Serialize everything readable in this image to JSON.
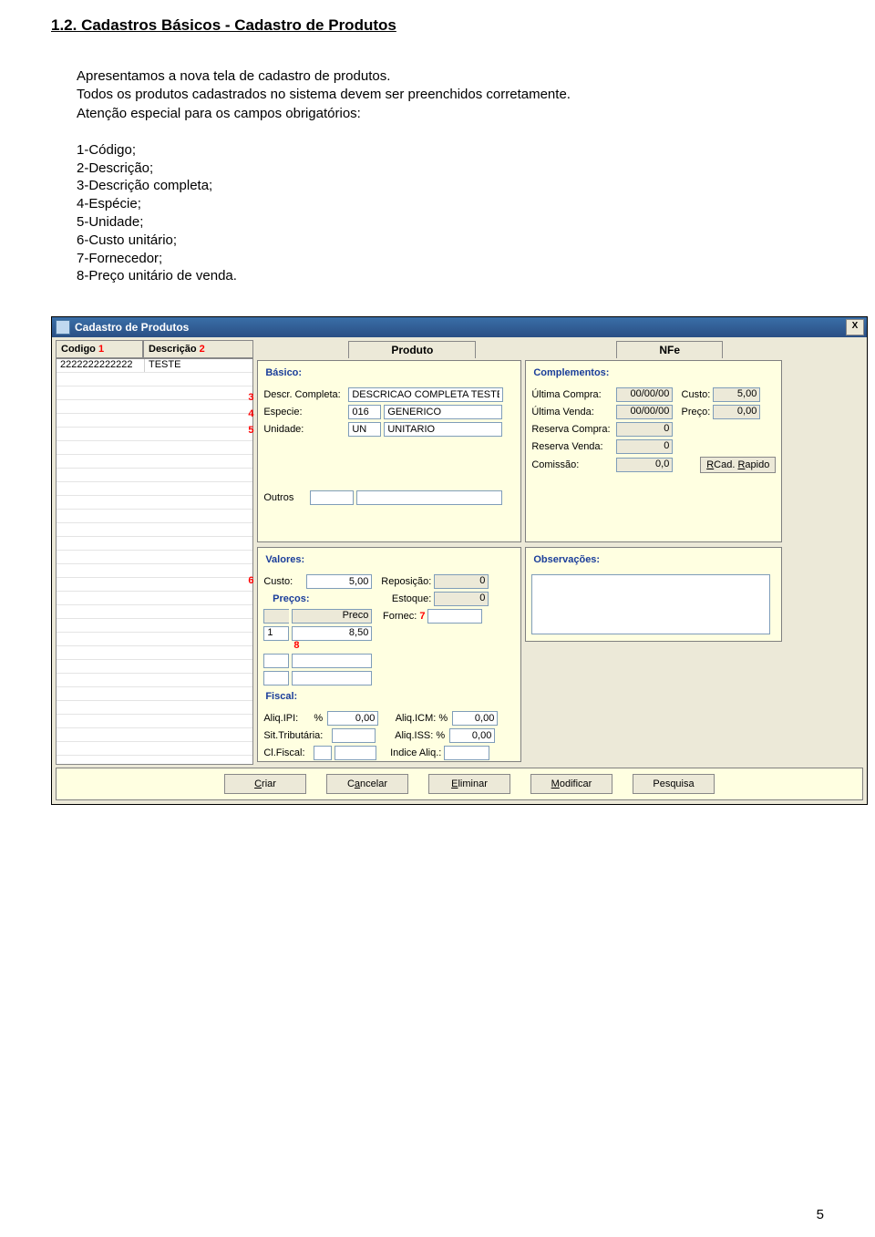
{
  "doc": {
    "heading": "1.2. Cadastros Básicos - Cadastro de Produtos",
    "intro": "Apresentamos a nova tela de cadastro de produtos.\nTodos os produtos cadastrados no sistema devem ser preenchidos corretamente.\nAtenção especial para os campos obrigatórios:",
    "fields": [
      "1-Código;",
      "2-Descrição;",
      "3-Descrição completa;",
      "4-Espécie;",
      "5-Unidade;",
      "6-Custo unitário;",
      "7-Fornecedor;",
      "8-Preço unitário de venda."
    ],
    "page_no": "5"
  },
  "annotations": {
    "a1": "1",
    "a2": "2",
    "a3": "3",
    "a4": "4",
    "a5": "5",
    "a6": "6",
    "a7": "7",
    "a8": "8"
  },
  "window": {
    "title": "Cadastro de Produtos",
    "list_headers": {
      "codigo": "Codigo",
      "descricao": "Descrição"
    },
    "list_row": {
      "codigo": "2222222222222",
      "descricao": "TESTE"
    },
    "tabs": {
      "produto": "Produto",
      "nfe": "NFe"
    },
    "basico": {
      "title": "Básico:",
      "descr_label": "Descr. Completa:",
      "descr_val": "DESCRICAO COMPLETA TESTE",
      "especie_label": "Especie:",
      "especie_code": "016",
      "especie_name": "GENERICO",
      "unidade_label": "Unidade:",
      "unidade_code": "UN",
      "unidade_name": "UNITARIO",
      "outros": "Outros"
    },
    "complementos": {
      "title": "Complementos:",
      "ult_compra_lab": "Última Compra:",
      "ult_compra_val": "00/00/00",
      "custo_lab": "Custo:",
      "custo_val": "5,00",
      "ult_venda_lab": "Última Venda:",
      "ult_venda_val": "00/00/00",
      "preco_lab": "Preço:",
      "preco_val": "0,00",
      "res_compra_lab": "Reserva Compra:",
      "res_compra_val": "0",
      "res_venda_lab": "Reserva Venda:",
      "res_venda_val": "0",
      "comissao_lab": "Comissão:",
      "comissao_val": "0,0",
      "cad_rapido": "Cad. Rapido"
    },
    "valores": {
      "title": "Valores:",
      "custo_lab": "Custo:",
      "custo_val": "5,00",
      "repos_lab": "Reposição:",
      "repos_val": "0",
      "precos_lab": "Preços:",
      "estoque_lab": "Estoque:",
      "estoque_val": "0",
      "preco_h": "Preco",
      "fornec_lab": "Fornec:",
      "line1_col1": "1",
      "line1_col2": "8,50",
      "fiscal_title": "Fiscal:",
      "aliq_ipi_lab": "Aliq.IPI:",
      "pct": "%",
      "aliq_ipi_val": "0,00",
      "aliq_icm_lab": "Aliq.ICM:",
      "aliq_icm_val": "0,00",
      "sit_trib_lab": "Sit.Tributária:",
      "sit_trib_val": "",
      "aliq_iss_lab": "Aliq.ISS:",
      "aliq_iss_val": "0,00",
      "cl_fiscal_lab": "Cl.Fiscal:",
      "indice_lab": "Indice Aliq.:"
    },
    "obs": {
      "title": "Observações:"
    },
    "cmd": {
      "criar": "Criar",
      "cancelar": "Cancelar",
      "eliminar": "Eliminar",
      "modificar": "Modificar",
      "pesquisa": "Pesquisa"
    }
  }
}
